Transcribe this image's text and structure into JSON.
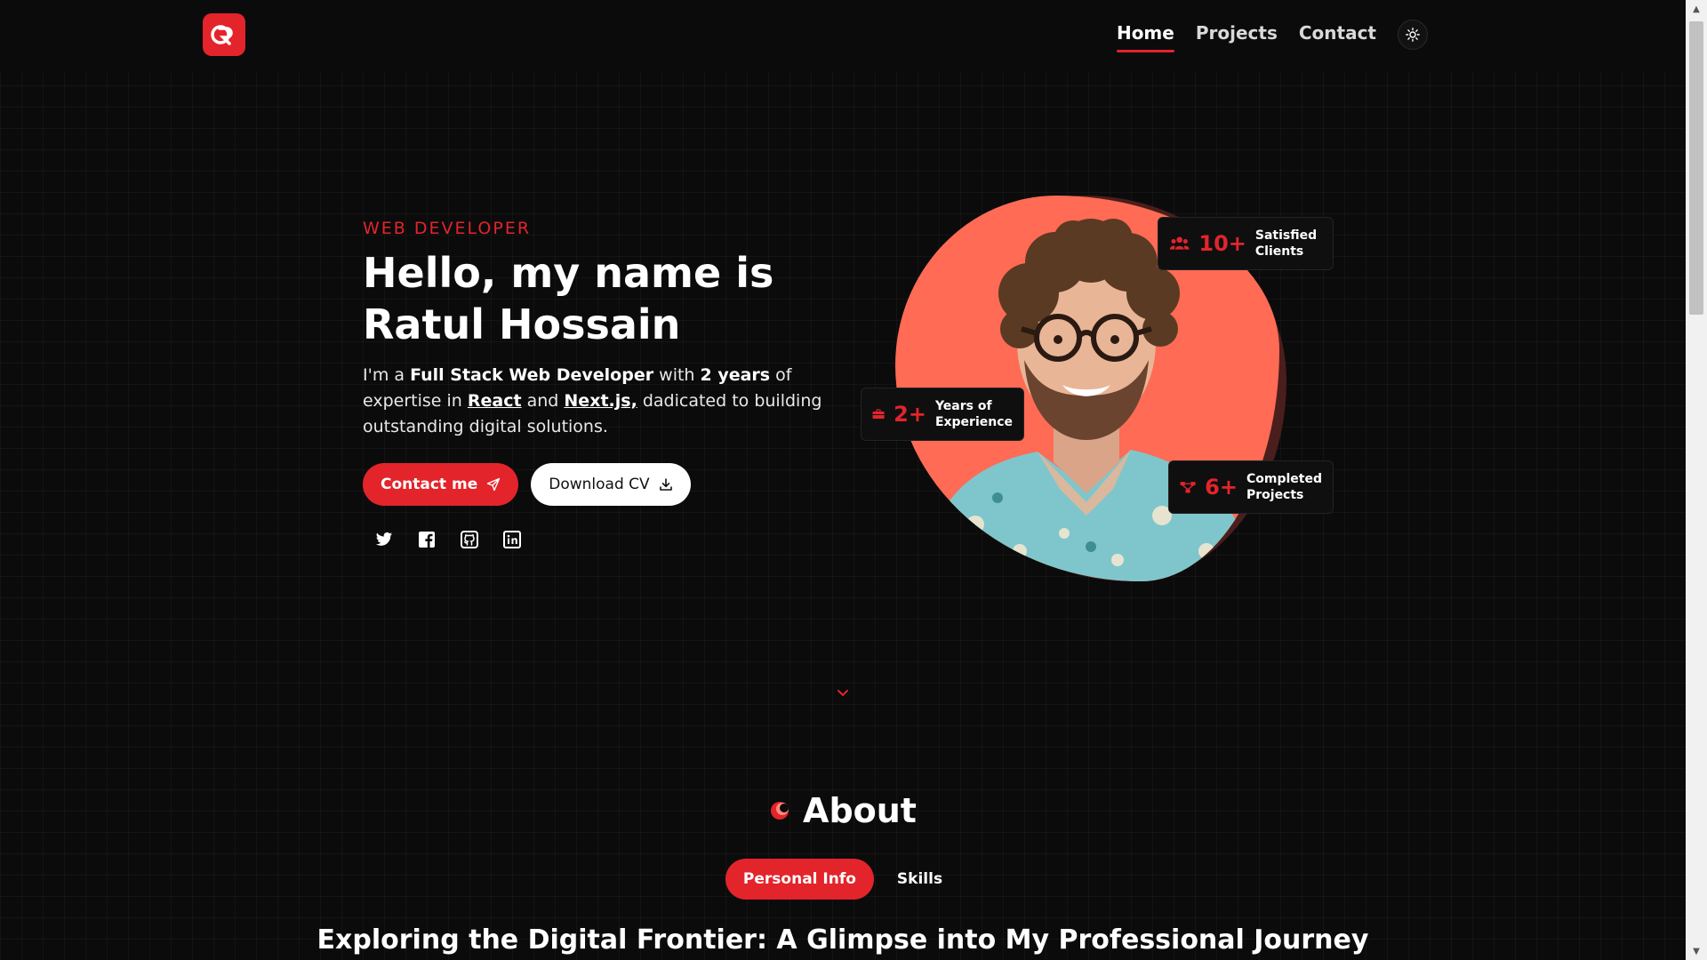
{
  "header": {
    "logo_alt": "R",
    "nav": [
      {
        "label": "Home",
        "active": true
      },
      {
        "label": "Projects",
        "active": false
      },
      {
        "label": "Contact",
        "active": false
      }
    ]
  },
  "hero": {
    "eyebrow": "WEB DEVELOPER",
    "title_line1": "Hello, my name is",
    "title_line2": "Ratul Hossain",
    "desc": {
      "p1": "I'm a ",
      "role": "Full Stack Web Developer",
      "p2": " with ",
      "years": "2 years",
      "p3": " of expertise in ",
      "tech1": "React",
      "p4": " and ",
      "tech2": "Next.js,",
      "p5": " dadicated to building outstanding digital solutions."
    },
    "cta_primary": "Contact me",
    "cta_secondary": "Download CV",
    "socials": [
      "twitter-icon",
      "facebook-icon",
      "github-icon",
      "linkedin-icon"
    ]
  },
  "stats": [
    {
      "num": "10+",
      "label": "Satisfied Clients",
      "icon": "users-icon"
    },
    {
      "num": "2+",
      "label": "Years of Experience",
      "icon": "briefcase-icon"
    },
    {
      "num": "6+",
      "label": "Completed Projects",
      "icon": "network-icon"
    }
  ],
  "about": {
    "title": "About",
    "tabs": [
      {
        "label": "Personal Info",
        "active": true
      },
      {
        "label": "Skills",
        "active": false
      }
    ],
    "heading": "Exploring the Digital Frontier: A Glimpse into My Professional Journey"
  },
  "colors": {
    "accent": "#e3242b",
    "portrait_bg": "#ff6b55",
    "background": "#0b0b0c"
  }
}
